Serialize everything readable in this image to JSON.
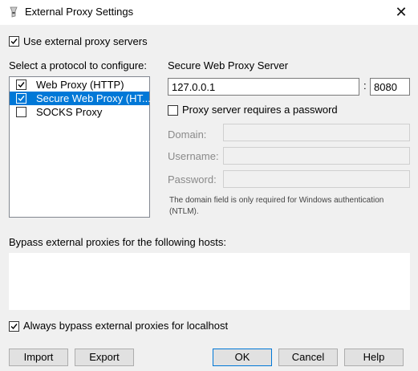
{
  "window": {
    "title": "External Proxy Settings",
    "close_icon": "✕"
  },
  "use_external": {
    "label": "Use external proxy servers",
    "checked": true
  },
  "protocols": {
    "heading": "Select a protocol to configure:",
    "items": [
      {
        "label": "Web Proxy (HTTP)",
        "checked": true,
        "selected": false
      },
      {
        "label": "Secure Web Proxy (HT...",
        "checked": true,
        "selected": true
      },
      {
        "label": "SOCKS Proxy",
        "checked": false,
        "selected": false
      }
    ]
  },
  "server": {
    "heading": "Secure Web Proxy Server",
    "host": "127.0.0.1",
    "separator": ":",
    "port": "8080",
    "requires_password": {
      "label": "Proxy server requires a password",
      "checked": false
    },
    "domain_label": "Domain:",
    "username_label": "Username:",
    "password_label": "Password:",
    "note": "The domain field is only required for Windows authentication (NTLM)."
  },
  "bypass": {
    "heading": "Bypass external proxies for the following hosts:",
    "hosts": "",
    "localhost": {
      "label": "Always bypass external proxies for localhost",
      "checked": true
    }
  },
  "buttons": {
    "import": "Import",
    "export": "Export",
    "ok": "OK",
    "cancel": "Cancel",
    "help": "Help"
  },
  "colors": {
    "selection": "#0078d7",
    "background": "#f0f0f0"
  }
}
